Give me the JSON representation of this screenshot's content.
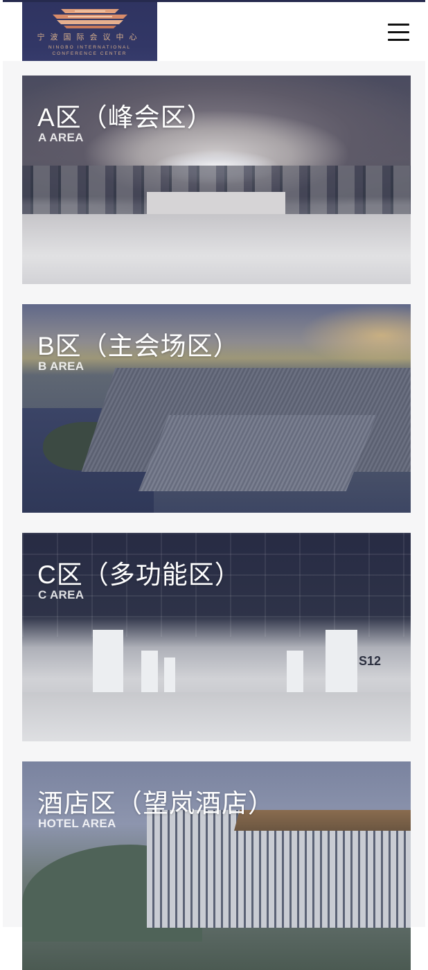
{
  "header": {
    "logo": {
      "cn": "宁波国际会议中心",
      "en_line1": "NINGBO INTERNATIONAL",
      "en_line2": "CONFERENCE CENTER"
    },
    "menu_icon": "hamburger-menu-icon"
  },
  "areas": [
    {
      "title": "A区（峰会区）",
      "subtitle": "A AREA"
    },
    {
      "title": "B区（主会场区）",
      "subtitle": "B AREA"
    },
    {
      "title": "C区（多功能区）",
      "subtitle": "C AREA"
    },
    {
      "title": "酒店区（望岚酒店）",
      "subtitle": "HOTEL AREA"
    }
  ],
  "photo_labels": {
    "hall_number": "S12"
  },
  "colors": {
    "brand_navy": "#2f3461",
    "logo_gold": "#d9b08c",
    "content_bg": "#f6f6f7"
  }
}
